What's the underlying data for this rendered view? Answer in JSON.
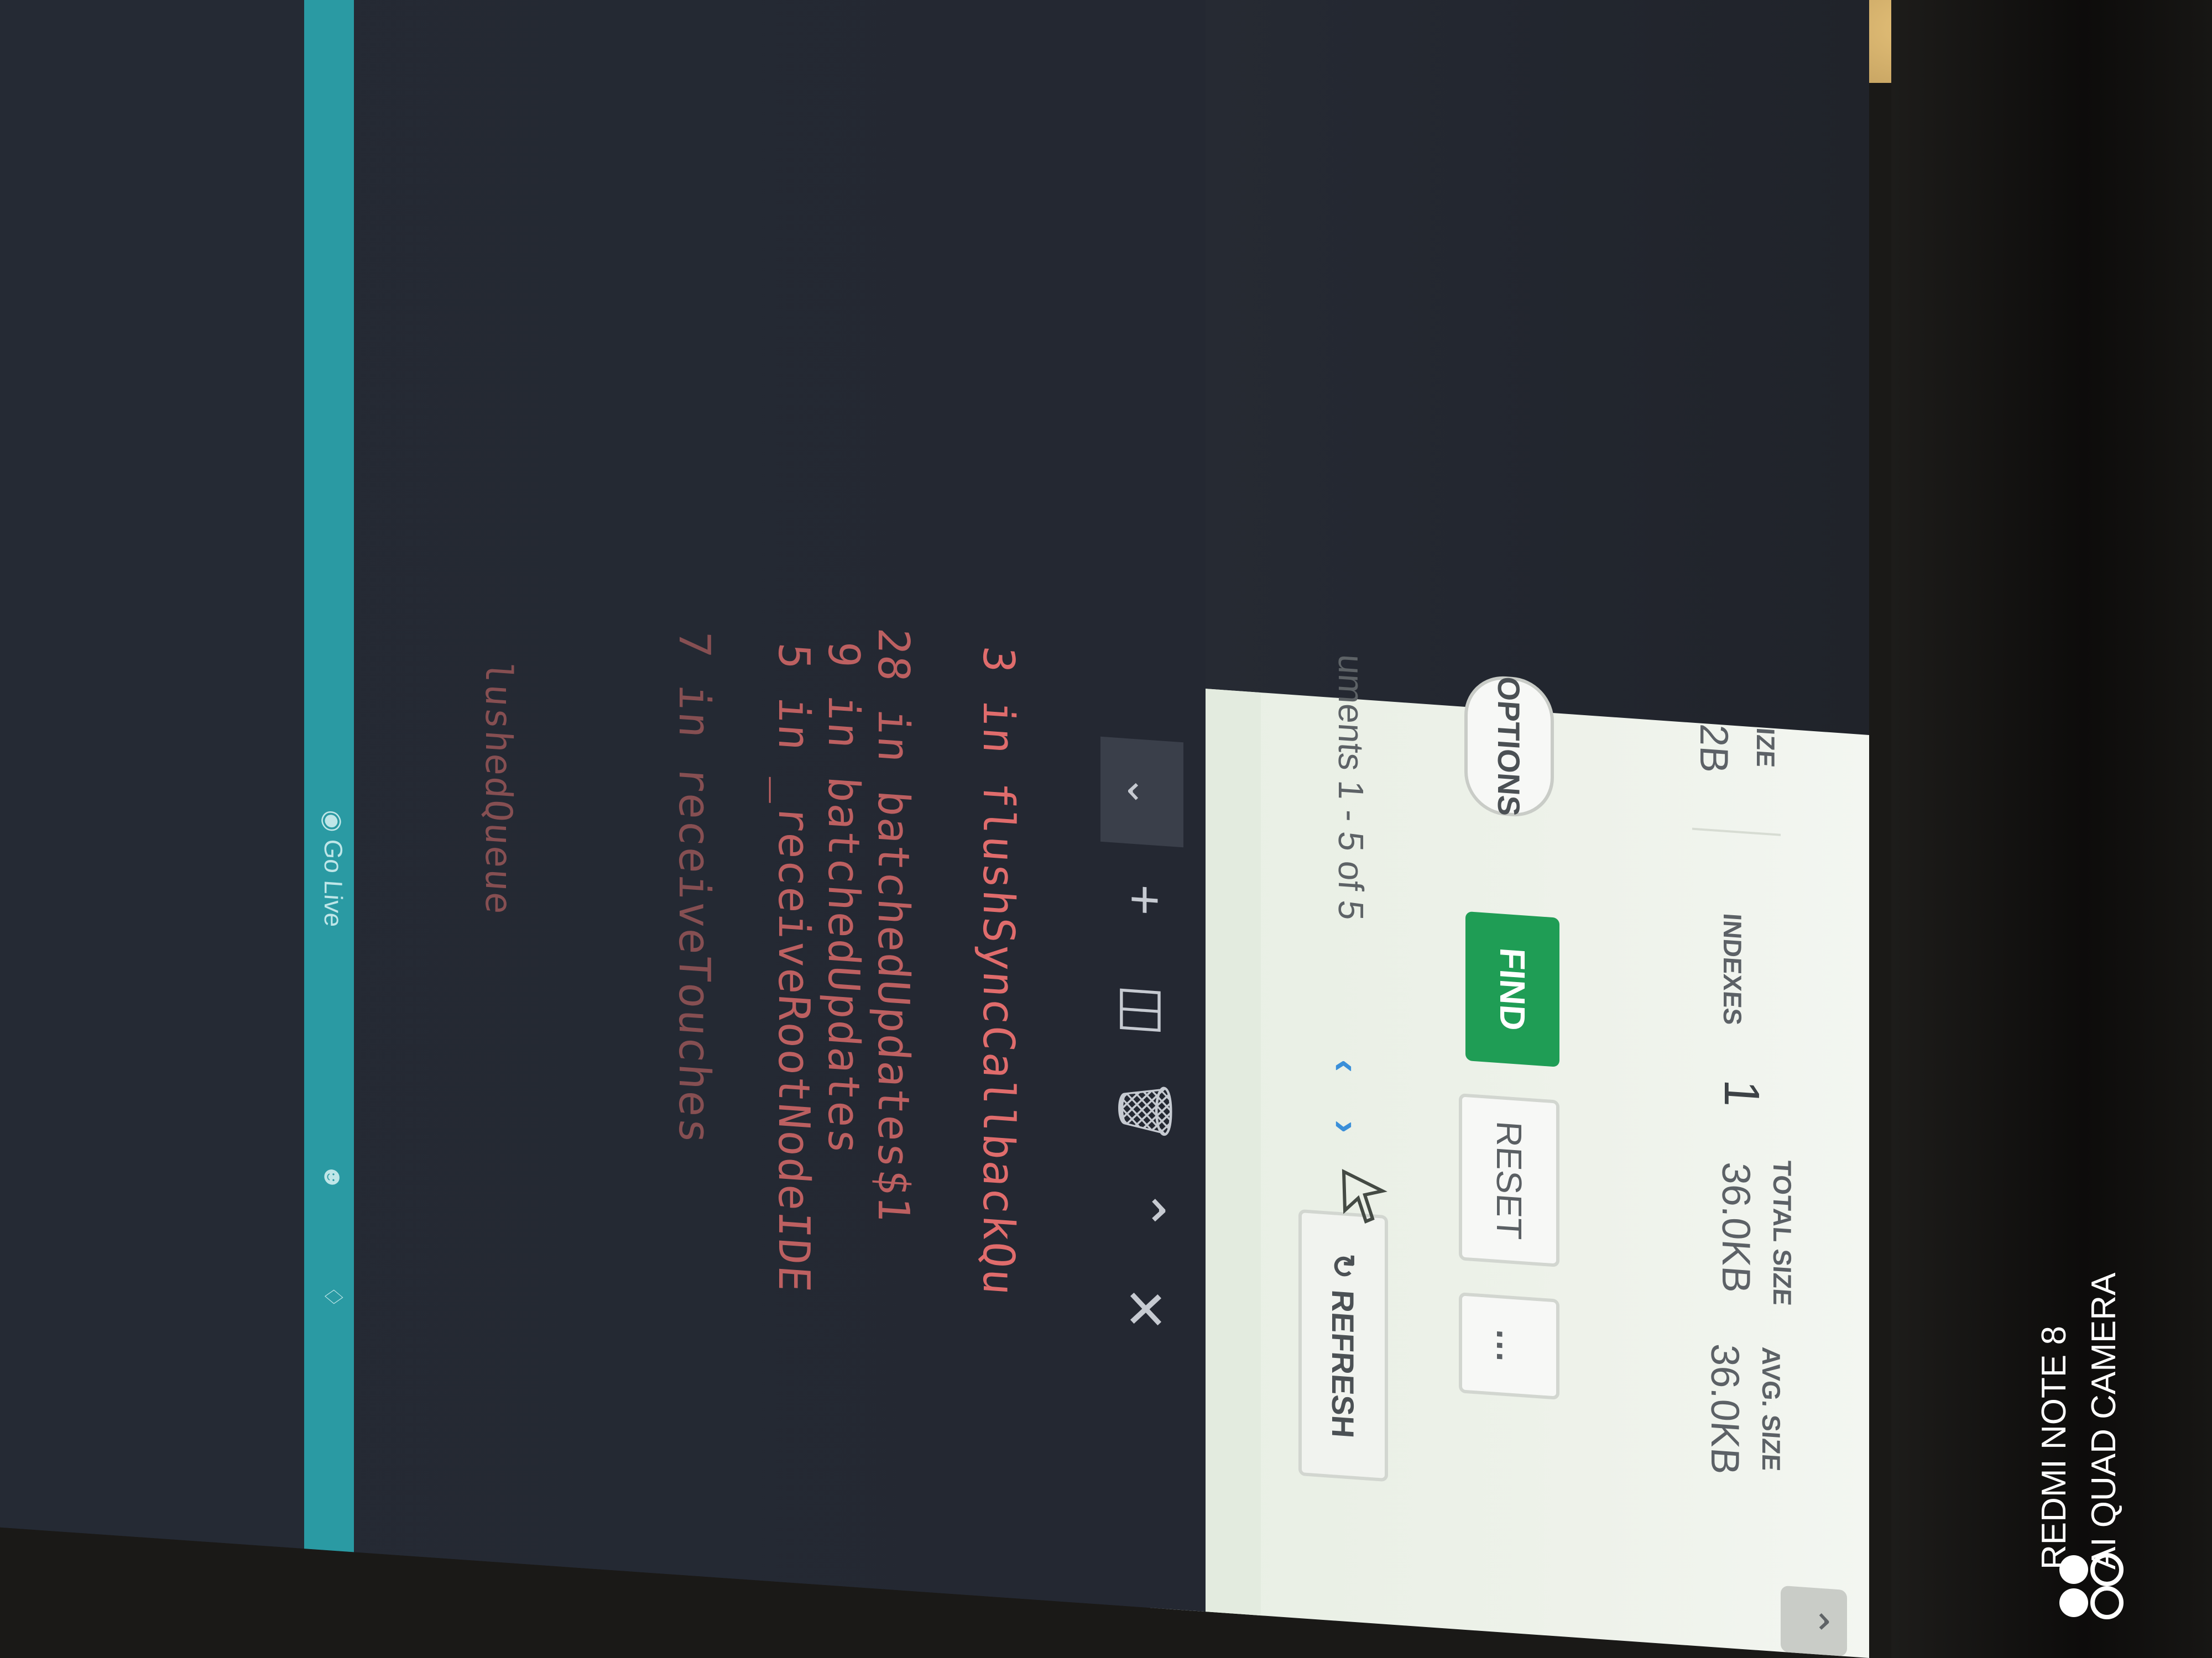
{
  "compass": {
    "stats": {
      "storage_size_label_partial": "IZE",
      "storage_size_value_partial": "2B",
      "indexes_label": "INDEXES",
      "indexes_value": "1",
      "total_size_label": "TOTAL SIZE",
      "total_size_value": "36.0KB",
      "avg_size_label": "AVG. SIZE",
      "avg_size_value": "36.0KB"
    },
    "toolbar": {
      "options_label": "OPTIONS",
      "find_label": "FIND",
      "reset_label": "RESET",
      "more_label": "…"
    },
    "pager": {
      "doc_count_text": "uments 1 - 5 of 5",
      "prev_icon": "chevron-left-icon",
      "next_icon": "chevron-right-icon",
      "refresh_label": "REFRESH"
    },
    "collapse_icon": "chevron-up-icon"
  },
  "terminal": {
    "toolbar_icons": [
      "chevron-down-icon",
      "plus-icon",
      "split-icon",
      "trash-icon",
      "chevron-up-icon",
      "close-icon"
    ],
    "lines": [
      "3 in flushSyncCallbackQu",
      "28 in batchedUpdates$1",
      "9 in batchedUpdates",
      "5 in _receiveRootNodeIDE",
      "7 in receiveTouches",
      "lushedQueue"
    ]
  },
  "status_bar": {
    "go_live": "Go Live"
  },
  "watermark": {
    "line1": "REDMI NOTE 8",
    "line2": "AI QUAD CAMERA"
  },
  "colors": {
    "find_button": "#1f9d55",
    "terminal_error_text": "#e06c6c",
    "status_bar": "#2a9aa3",
    "pager_link": "#3a8fd9"
  }
}
